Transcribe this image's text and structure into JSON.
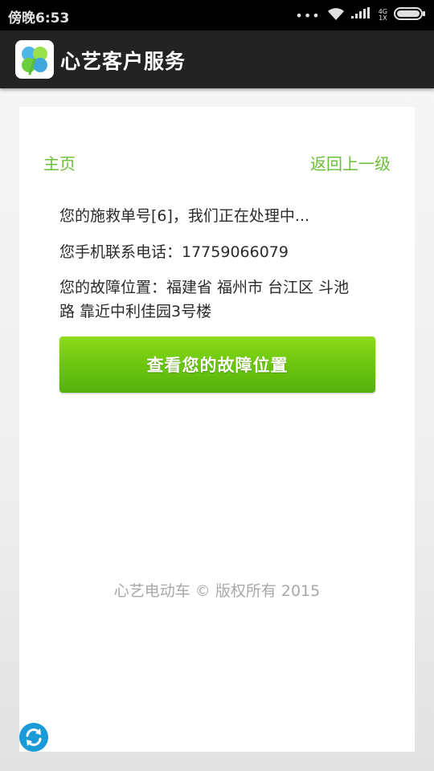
{
  "status_bar": {
    "time": "傍晚6:53",
    "more": "•••",
    "network_top": "4G",
    "network_bottom": "1X"
  },
  "app_bar": {
    "title": "心艺客户服务",
    "logo": "four-leaf-clover-logo"
  },
  "nav": {
    "home_label": "主页",
    "back_label": "返回上一级"
  },
  "info": {
    "rescue_line": "您的施救单号[6]，我们正在处理中...",
    "phone_line": "您手机联系电话：17759066079",
    "location_line_1": "您的故障位置：福建省 福州市 台江区 斗池",
    "location_line_2": "路 靠近中利佳园3号楼"
  },
  "button": {
    "view_location_label": "查看您的故障位置"
  },
  "footer": {
    "copyright": "心艺电动车 © 版权所有 2015"
  },
  "icons": {
    "refresh": "refresh-icon",
    "wifi": "wifi-icon",
    "signal": "signal-icon",
    "battery": "battery-icon"
  },
  "colors": {
    "accent_green": "#6abf3a",
    "button_green": "#6ec810",
    "refresh_blue": "#1a9ad6",
    "app_bar": "#232323"
  }
}
